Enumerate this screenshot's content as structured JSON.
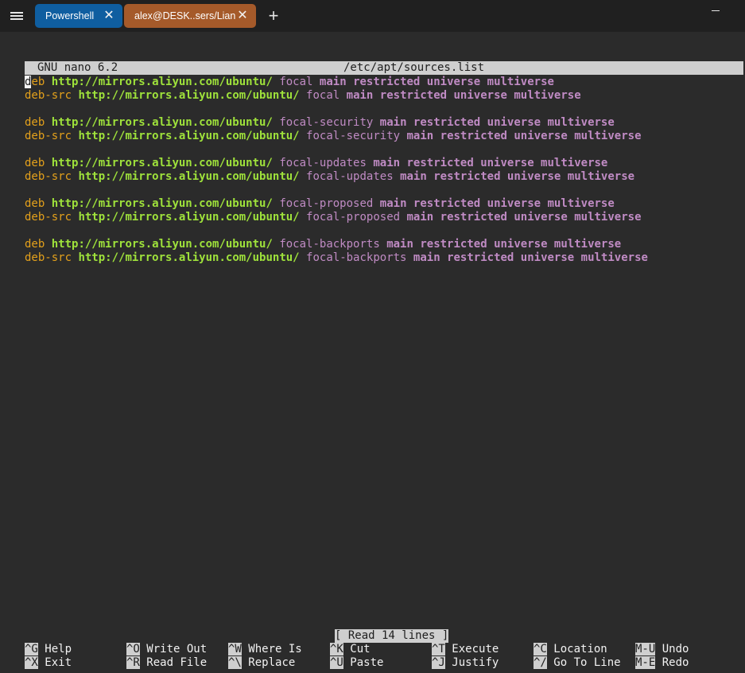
{
  "titlebar": {
    "tabs": [
      {
        "label": "Powershell",
        "close": "✕",
        "color": "#0f5ea0"
      },
      {
        "label": "alex@DESK..sers/Lian",
        "close": "✕",
        "color": "#a55a2a"
      }
    ],
    "new_tab": "+"
  },
  "nano": {
    "program": "GNU nano 6.2",
    "filename": "/etc/apt/sources.list",
    "status": "[ Read 14 lines ]"
  },
  "lines": [
    {
      "type": "deb",
      "url": "http://mirrors.aliyun.com/ubuntu/",
      "suite": "focal",
      "components": "main restricted universe multiverse"
    },
    {
      "type": "deb-src",
      "url": "http://mirrors.aliyun.com/ubuntu/",
      "suite": "focal",
      "components": "main restricted universe multiverse"
    },
    {
      "type": "deb",
      "url": "http://mirrors.aliyun.com/ubuntu/",
      "suite": "focal-security",
      "components": "main restricted universe multiverse"
    },
    {
      "type": "deb-src",
      "url": "http://mirrors.aliyun.com/ubuntu/",
      "suite": "focal-security",
      "components": "main restricted universe multiverse"
    },
    {
      "type": "deb",
      "url": "http://mirrors.aliyun.com/ubuntu/",
      "suite": "focal-updates",
      "components": "main restricted universe multiverse"
    },
    {
      "type": "deb-src",
      "url": "http://mirrors.aliyun.com/ubuntu/",
      "suite": "focal-updates",
      "components": "main restricted universe multiverse"
    },
    {
      "type": "deb",
      "url": "http://mirrors.aliyun.com/ubuntu/",
      "suite": "focal-proposed",
      "components": "main restricted universe multiverse"
    },
    {
      "type": "deb-src",
      "url": "http://mirrors.aliyun.com/ubuntu/",
      "suite": "focal-proposed",
      "components": "main restricted universe multiverse"
    },
    {
      "type": "deb",
      "url": "http://mirrors.aliyun.com/ubuntu/",
      "suite": "focal-backports",
      "components": "main restricted universe multiverse"
    },
    {
      "type": "deb-src",
      "url": "http://mirrors.aliyun.com/ubuntu/",
      "suite": "focal-backports",
      "components": "main restricted universe multiverse"
    }
  ],
  "shortcuts": {
    "row1": [
      {
        "key": "^G",
        "label": "Help"
      },
      {
        "key": "^O",
        "label": "Write Out"
      },
      {
        "key": "^W",
        "label": "Where Is"
      },
      {
        "key": "^K",
        "label": "Cut"
      },
      {
        "key": "^T",
        "label": "Execute"
      },
      {
        "key": "^C",
        "label": "Location"
      },
      {
        "key": "M-U",
        "label": "Undo"
      }
    ],
    "row2": [
      {
        "key": "^X",
        "label": "Exit"
      },
      {
        "key": "^R",
        "label": "Read File"
      },
      {
        "key": "^\\",
        "label": "Replace"
      },
      {
        "key": "^U",
        "label": "Paste"
      },
      {
        "key": "^J",
        "label": "Justify"
      },
      {
        "key": "^/",
        "label": "Go To Line"
      },
      {
        "key": "M-E",
        "label": "Redo"
      }
    ]
  },
  "colors": {
    "keyword": "#e4a11b",
    "url": "#9fe23b",
    "suite": "#c08bc4",
    "background": "#2b2b2b"
  }
}
